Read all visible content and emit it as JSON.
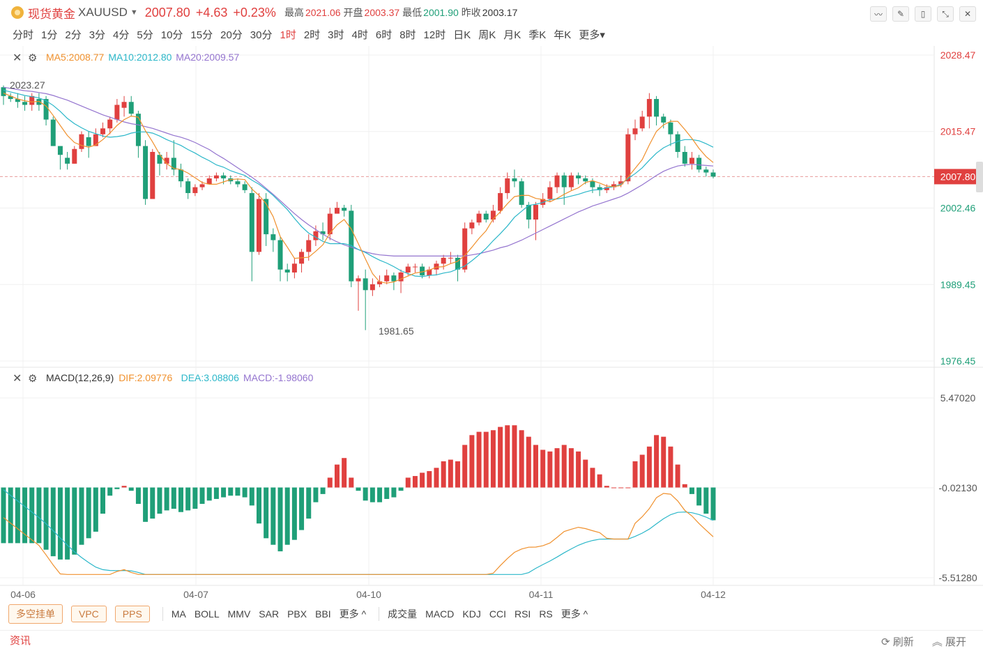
{
  "header": {
    "name": "现货黄金",
    "code": "XAUUSD",
    "price": "2007.80",
    "change": "+4.63",
    "change_pct": "+0.23%",
    "high_label": "最高",
    "high": "2021.06",
    "open_label": "开盘",
    "open": "2003.37",
    "low_label": "最低",
    "low": "2001.90",
    "prev_label": "昨收",
    "prev": "2003.17"
  },
  "periods": [
    "分时",
    "1分",
    "2分",
    "3分",
    "4分",
    "5分",
    "10分",
    "15分",
    "20分",
    "30分",
    "1时",
    "2时",
    "3时",
    "4时",
    "6时",
    "8时",
    "12时",
    "日K",
    "周K",
    "月K",
    "季K",
    "年K",
    "更多"
  ],
  "active_period": "1时",
  "ma_legend": {
    "ma5": "MA5:2008.77",
    "ma10": "MA10:2012.80",
    "ma20": "MA20:2009.57"
  },
  "macd_legend": {
    "title": "MACD(12,26,9)",
    "dif": "DIF:2.09776",
    "dea": "DEA:3.08806",
    "macd": "MACD:-1.98060"
  },
  "bottom": {
    "pills": [
      "多空挂单",
      "VPC",
      "PPS"
    ],
    "main_ind": [
      "MA",
      "BOLL",
      "MMV",
      "SAR",
      "PBX",
      "BBI",
      "更多 ^"
    ],
    "sub_ind": [
      "成交量",
      "MACD",
      "KDJ",
      "CCI",
      "RSI",
      "RS",
      "更多 ^"
    ]
  },
  "news": {
    "label": "资讯",
    "refresh": "刷新",
    "expand": "展开"
  },
  "colors": {
    "up": "#e0403f",
    "down": "#1f9f78",
    "ma5": "#f0912e",
    "ma10": "#2bb7c9",
    "ma20": "#9474cf"
  },
  "chart_data": {
    "type": "candlestick",
    "price_axis": {
      "ylim": [
        1976.45,
        2028.47
      ],
      "ticks": [
        "2028.47",
        "2015.47",
        "2002.46",
        "1989.45",
        "1976.45"
      ],
      "current": "2007.80"
    },
    "macd_axis": {
      "ylim": [
        -5.5128,
        5.4702
      ],
      "ticks": [
        "5.47020",
        "-0.02130",
        "-5.51280"
      ]
    },
    "x_labels": [
      "04-06",
      "04-07",
      "04-10",
      "04-11",
      "04-12"
    ],
    "annotations": {
      "max": "2023.27",
      "min": "1981.65"
    },
    "ohlc": [
      [
        2023,
        2021.5,
        2023.3,
        2020
      ],
      [
        2021.5,
        2021,
        2022,
        2020.5
      ],
      [
        2021,
        2020.5,
        2022,
        2019.5
      ],
      [
        2020.5,
        2020,
        2021.5,
        2019
      ],
      [
        2020,
        2021.5,
        2022,
        2019
      ],
      [
        2021,
        2020,
        2022,
        2019
      ],
      [
        2021,
        2017.5,
        2021.5,
        2016.5
      ],
      [
        2017.5,
        2013,
        2018,
        2013
      ],
      [
        2013,
        2011.5,
        2013,
        2009
      ],
      [
        2011,
        2010,
        2012,
        2009
      ],
      [
        2010,
        2012.5,
        2013,
        2010
      ],
      [
        2012.5,
        2015,
        2015.5,
        2012
      ],
      [
        2014.5,
        2013,
        2015.5,
        2011
      ],
      [
        2013,
        2015,
        2016,
        2013
      ],
      [
        2015,
        2016,
        2017,
        2014.5
      ],
      [
        2016,
        2017.5,
        2018,
        2015
      ],
      [
        2017.5,
        2020,
        2021,
        2017
      ],
      [
        2019.5,
        2020.5,
        2021.5,
        2018
      ],
      [
        2020.5,
        2018.5,
        2021.5,
        2018
      ],
      [
        2018.5,
        2013,
        2019,
        2011
      ],
      [
        2013,
        2004,
        2014,
        2003
      ],
      [
        2004,
        2012,
        2012.5,
        2004
      ],
      [
        2011.5,
        2010,
        2012,
        2008
      ],
      [
        2010,
        2011,
        2012,
        2009
      ],
      [
        2011,
        2009,
        2014,
        2008
      ],
      [
        2009,
        2007,
        2010,
        2006
      ],
      [
        2007,
        2005,
        2007.5,
        2004
      ],
      [
        2005,
        2006,
        2006.5,
        2004.5
      ],
      [
        2006,
        2006.5,
        2007,
        2005.5
      ],
      [
        2006.5,
        2007.5,
        2008,
        2006.5
      ],
      [
        2007.5,
        2008,
        2008.5,
        2007
      ],
      [
        2008,
        2007.5,
        2008.5,
        2006.5
      ],
      [
        2007.5,
        2007,
        2008,
        2006.5
      ],
      [
        2007,
        2006.5,
        2007.5,
        2006
      ],
      [
        2006.5,
        2005.5,
        2007,
        2005
      ],
      [
        2005,
        1995,
        2006,
        1990
      ],
      [
        1995,
        2004,
        2005,
        1994.5
      ],
      [
        2004,
        1998,
        2005,
        1996
      ],
      [
        1998,
        1997,
        1999,
        1995
      ],
      [
        1997,
        1992,
        1997.5,
        1990
      ],
      [
        1992,
        1991.5,
        1993,
        1990
      ],
      [
        1991.5,
        1993,
        1994,
        1990.5
      ],
      [
        1993,
        1995,
        1995.5,
        1991.5
      ],
      [
        1995,
        1997,
        1998,
        1993.5
      ],
      [
        1997,
        1998.5,
        1999.5,
        1996
      ],
      [
        1998.5,
        1998,
        2000,
        1997
      ],
      [
        1998,
        2001.5,
        2002.5,
        1997
      ],
      [
        2001.5,
        2002.5,
        2003.5,
        2001.5
      ],
      [
        2002.5,
        2002,
        2003,
        2001
      ],
      [
        2002,
        1990,
        2003,
        1989
      ],
      [
        1990,
        1990.5,
        1991,
        1985
      ],
      [
        1990.5,
        1988.5,
        1992,
        1981.7
      ],
      [
        1988.5,
        1989.5,
        1990.5,
        1987.5
      ],
      [
        1989.5,
        1990,
        1991,
        1989
      ],
      [
        1990,
        1991,
        1992,
        1989.5
      ],
      [
        1991,
        1990,
        1991.5,
        1988.5
      ],
      [
        1990,
        1991.5,
        1992,
        1988
      ],
      [
        1991.5,
        1992.5,
        1993,
        1991
      ],
      [
        1992.5,
        1992.5,
        1993,
        1991.5
      ],
      [
        1992.5,
        1991,
        1993,
        1990.5
      ],
      [
        1991,
        1992,
        1992.5,
        1990.5
      ],
      [
        1992,
        1993,
        1993.5,
        1991
      ],
      [
        1993,
        1994,
        1994.5,
        1992
      ],
      [
        1994,
        1994,
        1995,
        1993
      ],
      [
        1994,
        1992,
        1994.5,
        1990
      ],
      [
        1992,
        1999,
        2000,
        1991.5
      ],
      [
        1999,
        2000,
        2000.5,
        1998
      ],
      [
        2000,
        2001.5,
        2002,
        1999.5
      ],
      [
        2001.5,
        2000.5,
        2002,
        2000
      ],
      [
        2000.5,
        2002,
        2003,
        2000
      ],
      [
        2002,
        2005,
        2006,
        2001.5
      ],
      [
        2005,
        2007.5,
        2008.5,
        2004
      ],
      [
        2007.5,
        2007,
        2009,
        2006
      ],
      [
        2007,
        2003,
        2007.5,
        2002.5
      ],
      [
        2003,
        2000.5,
        2003.5,
        1999
      ],
      [
        2000.5,
        2003,
        2003.5,
        1997
      ],
      [
        2003,
        2004,
        2005,
        2002.5
      ],
      [
        2004,
        2006,
        2007,
        2003.5
      ],
      [
        2006,
        2008,
        2008.5,
        2005
      ],
      [
        2008,
        2006,
        2008.5,
        2003
      ],
      [
        2006,
        2008,
        2008.5,
        2005.5
      ],
      [
        2008,
        2007.5,
        2008.5,
        2006.5
      ],
      [
        2007.5,
        2007,
        2008,
        2006.5
      ],
      [
        2007,
        2006,
        2007.5,
        2005
      ],
      [
        2006,
        2005.5,
        2006.5,
        2004.5
      ],
      [
        2005.5,
        2006,
        2006.5,
        2005
      ],
      [
        2006,
        2006.5,
        2007,
        2005.5
      ],
      [
        2006.5,
        2007,
        2008,
        2006
      ],
      [
        2007,
        2015,
        2016,
        2006.5
      ],
      [
        2015,
        2016,
        2017.5,
        2014
      ],
      [
        2016,
        2018,
        2019,
        2015.5
      ],
      [
        2018,
        2021,
        2022,
        2016
      ],
      [
        2021,
        2018,
        2021.5,
        2016.5
      ],
      [
        2018,
        2017,
        2018.5,
        2016
      ],
      [
        2017,
        2015,
        2017.5,
        2013
      ],
      [
        2015,
        2012,
        2015.5,
        2011
      ],
      [
        2012,
        2010,
        2013,
        2009.5
      ],
      [
        2010,
        2011,
        2012,
        2009
      ],
      [
        2011,
        2009,
        2011.5,
        2008.5
      ],
      [
        2009,
        2008.5,
        2009.5,
        2007.8
      ],
      [
        2008.5,
        2007.8,
        2009,
        2007.5
      ]
    ],
    "ma5": [
      2022,
      2021.5,
      2021,
      2020.7,
      2020.5,
      2020.6,
      2019.8,
      2018.2,
      2016.5,
      2014.8,
      2013.6,
      2013.1,
      2012.8,
      2013.2,
      2014.1,
      2015.2,
      2016.5,
      2017.5,
      2018.1,
      2017.9,
      2015.6,
      2013.7,
      2011.6,
      2010,
      2009.2,
      2009,
      2008.4,
      2007.6,
      2006.8,
      2006.5,
      2006.5,
      2006.9,
      2007.3,
      2007.4,
      2007.3,
      2005.7,
      2004.6,
      2003.2,
      2001,
      1997.6,
      1995.8,
      1993.9,
      1994,
      1994.1,
      1995.1,
      1996.2,
      1998.2,
      1999.6,
      2000.5,
      1998.9,
      1996.4,
      1993.8,
      1991.3,
      1989.9,
      1989.7,
      1989.9,
      1990.4,
      1990.9,
      1991.4,
      1991.6,
      1991.9,
      1992.4,
      1992.5,
      1993,
      1993.4,
      1994.4,
      1995.8,
      1997.3,
      1998.6,
      2000.6,
      2001.8,
      2003.2,
      2004.4,
      2004.6,
      2004.6,
      2004.1,
      2003.9,
      2003.5,
      2004.1,
      2004.8,
      2005.4,
      2005.9,
      2006.8,
      2007.1,
      2006.7,
      2006.2,
      2006.1,
      2006.3,
      2007.7,
      2009.2,
      2010.7,
      2013.2,
      2015.5,
      2016.6,
      2017.2,
      2017.2,
      2015.8,
      2014.3,
      2012.6,
      2011.2,
      2010.2
    ],
    "ma10": [
      2022.5,
      2022.2,
      2021.9,
      2021.6,
      2021.4,
      2021.2,
      2020.7,
      2019.9,
      2018.9,
      2017.7,
      2016.8,
      2016.1,
      2015.5,
      2015.1,
      2014.7,
      2014.5,
      2014.6,
      2014.8,
      2015.2,
      2015.4,
      2015.4,
      2015.2,
      2014.7,
      2014.1,
      2013.6,
      2013.1,
      2012.4,
      2011.8,
      2011.1,
      2010.5,
      2009.8,
      2009.4,
      2008.8,
      2008.4,
      2008,
      2007.2,
      2006.5,
      2005.6,
      2004.6,
      2003.4,
      2002.2,
      2000.7,
      1999.3,
      1998.2,
      1997.5,
      1996.8,
      1996.4,
      1996.4,
      1996.4,
      1996.1,
      1995.4,
      1994.9,
      1994.2,
      1993.6,
      1993.1,
      1992.5,
      1991.8,
      1991.3,
      1990.9,
      1990.8,
      1991,
      1991.1,
      1991.4,
      1991.6,
      1992.1,
      1992.6,
      1993.5,
      1994.5,
      1995.6,
      1996.9,
      1998.1,
      1999.4,
      2000.9,
      2001.9,
      2002.9,
      2003.1,
      2003.4,
      2003.9,
      2004,
      2004.2,
      2004.5,
      2004.8,
      2005.2,
      2005.5,
      2005.6,
      2005.9,
      2006.1,
      2006.5,
      2007.5,
      2008.3,
      2009.3,
      2010.6,
      2011.8,
      2012.7,
      2013.3,
      2013.8,
      2014.1,
      2014.1,
      2013.9,
      2013.4,
      2012.8
    ],
    "ma20": [
      2023,
      2022.8,
      2022.6,
      2022.4,
      2022.3,
      2022.1,
      2021.9,
      2021.6,
      2021.2,
      2020.8,
      2020.3,
      2019.8,
      2019.3,
      2018.8,
      2018.3,
      2017.9,
      2017.5,
      2017.1,
      2016.8,
      2016.6,
      2016.3,
      2016,
      2015.6,
      2015.2,
      2014.8,
      2014.5,
      2014.1,
      2013.6,
      2013,
      2012.4,
      2011.6,
      2010.9,
      2010.1,
      2009.3,
      2008.5,
      2007.7,
      2006.8,
      2005.8,
      2004.8,
      2003.7,
      2002.6,
      2001.5,
      2000.5,
      1999.6,
      1998.8,
      1998,
      1997.3,
      1996.7,
      1996.2,
      1995.8,
      1995.4,
      1995,
      1994.7,
      1994.5,
      1994.4,
      1994.3,
      1994.3,
      1994.3,
      1994.3,
      1994.3,
      1994.3,
      1994.3,
      1994.3,
      1994.3,
      1994.3,
      1994.3,
      1994.5,
      1994.7,
      1995,
      1995.3,
      1995.7,
      1996,
      1996.5,
      1997,
      1997.6,
      1998.2,
      1998.8,
      1999.4,
      2000,
      2000.6,
      2001.2,
      2001.8,
      2002.3,
      2002.8,
      2003.2,
      2003.6,
      2004,
      2004.4,
      2005,
      2005.7,
      2006.4,
      2007.2,
      2008,
      2008.7,
      2009.2,
      2009.6,
      2009.8,
      2009.9,
      2009.8,
      2009.7,
      2009.6
    ],
    "macd_hist": [
      -3.4,
      -3.4,
      -3.4,
      -3.4,
      -3.4,
      -3.4,
      -3.8,
      -4.2,
      -4.4,
      -4.4,
      -4.1,
      -3.5,
      -3.1,
      -2.7,
      -1.6,
      -0.5,
      -0.1,
      0.1,
      -0.2,
      -1,
      -2.1,
      -1.9,
      -1.6,
      -1.4,
      -1.3,
      -1.5,
      -1.4,
      -1.3,
      -1,
      -0.8,
      -0.7,
      -0.6,
      -0.5,
      -0.5,
      -0.6,
      -1.1,
      -2.2,
      -3.1,
      -3.5,
      -3.9,
      -3.5,
      -3.2,
      -2.6,
      -1.9,
      -0.9,
      -0.4,
      0.6,
      1.4,
      1.8,
      0.6,
      -0.2,
      -0.8,
      -0.9,
      -0.9,
      -0.7,
      -0.6,
      -0.2,
      0.6,
      0.7,
      0.9,
      1,
      1.2,
      1.6,
      1.7,
      1.6,
      2.6,
      3.2,
      3.4,
      3.4,
      3.5,
      3.7,
      3.8,
      3.8,
      3.5,
      3.1,
      2.6,
      2.3,
      2.2,
      2.4,
      2.6,
      2.4,
      2.2,
      1.7,
      1.2,
      0.8,
      0.1,
      0,
      0,
      0,
      1.6,
      2,
      2.5,
      3.2,
      3.1,
      2.5,
      1.4,
      0.2,
      -0.4,
      -1.1,
      -1.6,
      -2
    ]
  }
}
